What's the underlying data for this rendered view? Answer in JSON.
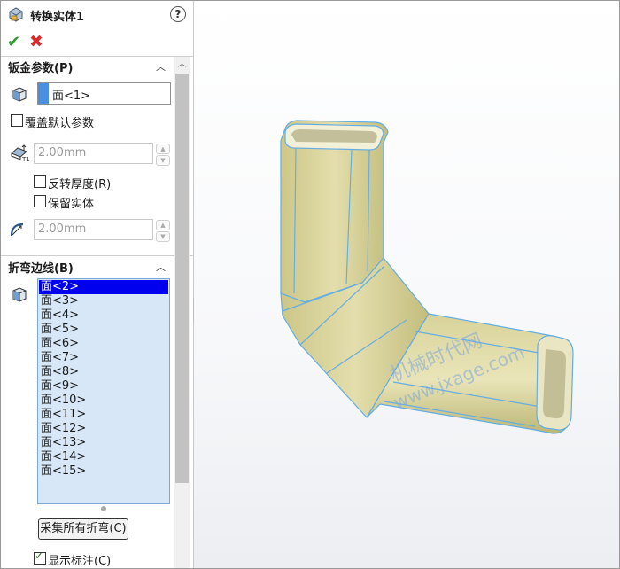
{
  "panel": {
    "title": "转换实体1",
    "help_icon": "question-circle-icon",
    "ok_icon": "check-icon",
    "cancel_icon": "close-icon"
  },
  "sheet_metal_params": {
    "header": "钣金参数(P)",
    "fixed_face_value": "面<1>",
    "override_defaults_label": "覆盖默认参数",
    "override_defaults_checked": false,
    "thickness_value": "2.00mm",
    "reverse_thickness_label": "反转厚度(R)",
    "reverse_thickness_checked": false,
    "keep_body_label": "保留实体",
    "keep_body_checked": false,
    "radius_value": "2.00mm"
  },
  "bend_edges": {
    "header": "折弯边线(B)",
    "items": [
      "面<2>",
      "面<3>",
      "面<4>",
      "面<5>",
      "面<6>",
      "面<7>",
      "面<8>",
      "面<9>",
      "面<10>",
      "面<11>",
      "面<12>",
      "面<13>",
      "面<14>",
      "面<15>"
    ],
    "selected_index": 0,
    "collect_button_label": "采集所有折弯(C)",
    "show_callouts_label": "显示标注(C)",
    "show_callouts_checked": true
  },
  "viewport": {
    "watermark_line1": "机械时代网",
    "watermark_line2": "www.jxage.com"
  },
  "colors": {
    "selection_blue": "#0000ee",
    "list_background": "#d7e7f8",
    "ok_green": "#2f9c2f",
    "cancel_red": "#d92b2b",
    "tube_fill": "#d9d49a",
    "tube_edge": "#5aa7e0"
  }
}
